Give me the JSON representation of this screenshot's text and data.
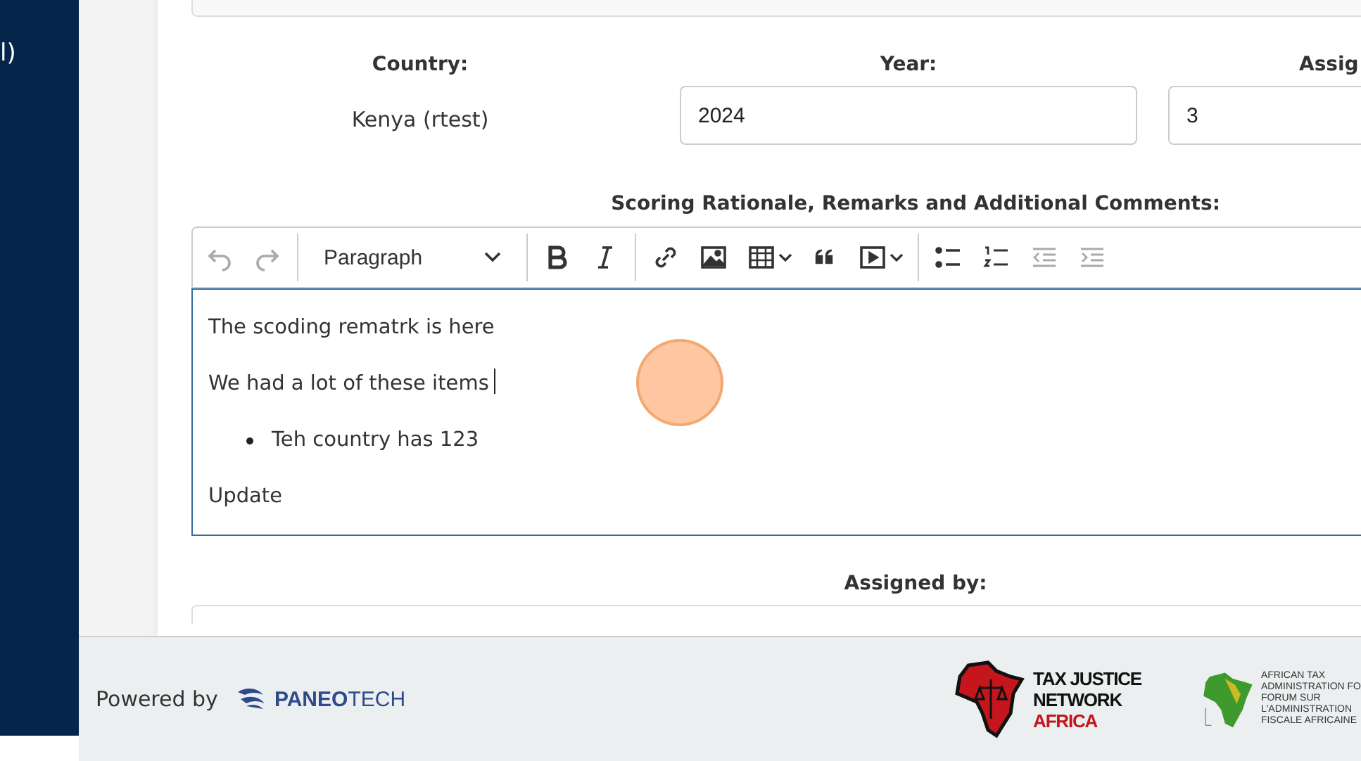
{
  "sidebar": {
    "fragment": "l)"
  },
  "form": {
    "fields": [
      {
        "label": "Country:",
        "kind": "text",
        "value": "Kenya (rtest)"
      },
      {
        "label": "Year:",
        "kind": "input",
        "value": "2024"
      },
      {
        "label": "Assig",
        "kind": "input",
        "value": "3"
      }
    ],
    "editor_label": "Scoring Rationale, Remarks and Additional Comments:",
    "toolbar": [
      {
        "kind": "undo",
        "disabled": true
      },
      {
        "kind": "redo",
        "disabled": true
      },
      {
        "kind": "sep"
      },
      {
        "kind": "heading",
        "text": "Paragraph",
        "disabled": false
      },
      {
        "kind": "sep"
      },
      {
        "kind": "bold",
        "disabled": false
      },
      {
        "kind": "italic",
        "disabled": false
      },
      {
        "kind": "sep"
      },
      {
        "kind": "link",
        "disabled": false
      },
      {
        "kind": "image",
        "disabled": false
      },
      {
        "kind": "table",
        "disabled": false
      },
      {
        "kind": "quote",
        "disabled": false
      },
      {
        "kind": "media",
        "disabled": false
      },
      {
        "kind": "sep"
      },
      {
        "kind": "bullets",
        "disabled": false
      },
      {
        "kind": "numbers",
        "disabled": false
      },
      {
        "kind": "outdent",
        "disabled": true
      },
      {
        "kind": "indent",
        "disabled": true
      }
    ],
    "content": [
      {
        "kind": "paragraph",
        "text": "The scoding rematrk is here",
        "caret": false
      },
      {
        "kind": "paragraph",
        "text": "We had a lot of these items",
        "caret": true
      },
      {
        "kind": "bullet",
        "text": "Teh country has 123",
        "caret": false
      },
      {
        "kind": "paragraph",
        "text": "Update",
        "caret": false
      }
    ],
    "assigned_label": "Assigned by:"
  },
  "footer": {
    "powered_by": "Powered by",
    "brand": "**PANEO**TECH",
    "tjn_logo": [
      "TAX JUSTICE",
      "NETWORK",
      "AFRICA"
    ],
    "ataf_logo": [
      "AFRICAN TAX",
      "ADMINISTRATION FO",
      "FORUM SUR",
      "L'ADMINISTRATION",
      "FISCALE AFRICAINE"
    ]
  }
}
